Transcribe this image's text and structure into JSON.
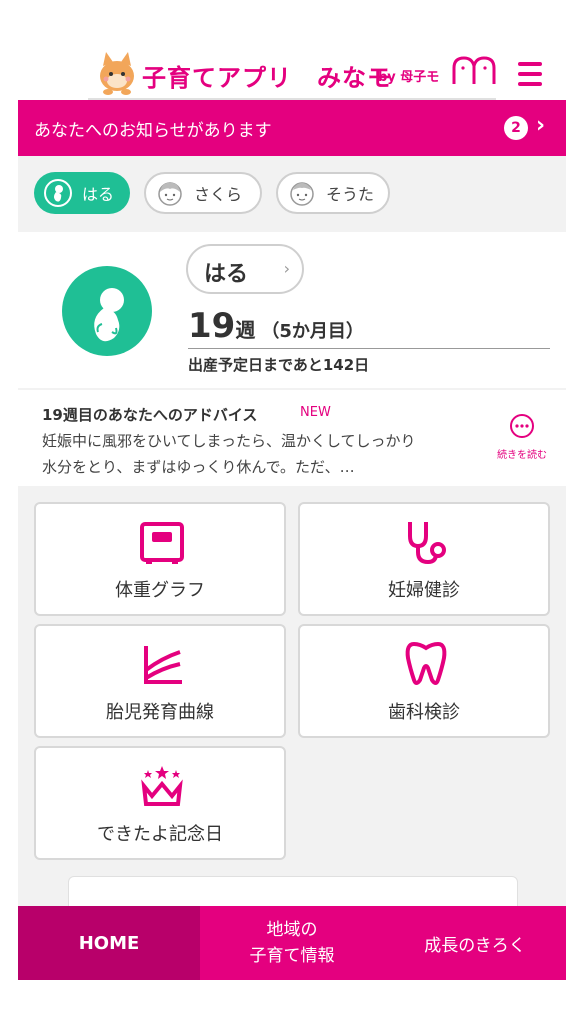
{
  "header": {
    "app_title": "子育てアプリ　みなモ",
    "by_label": "by 母子モ"
  },
  "notice": {
    "text": "あなたへのお知らせがあります",
    "count": "2"
  },
  "children": [
    {
      "name": "はる",
      "active": true
    },
    {
      "name": "さくら",
      "active": false
    },
    {
      "name": "そうた",
      "active": false
    }
  ],
  "profile": {
    "name": "はる",
    "week_number": "19",
    "week_unit": "週",
    "months": "（5か月目）",
    "due_text": "出産予定日まであと142日"
  },
  "advice": {
    "title": "19週目のあなたへのアドバイス",
    "badge": "NEW",
    "line1": "妊娠中に風邪をひいてしまったら、温かくしてしっかり",
    "line2": "水分をとり、まずはゆっくり休んで。ただ、…",
    "read_more": "続きを読む"
  },
  "menu": {
    "weight_graph": "体重グラフ",
    "checkup": "妊婦健診",
    "growth_curve": "胎児発育曲線",
    "dental": "歯科検診",
    "milestone": "できたよ記念日"
  },
  "bottom_nav": {
    "home": "HOME",
    "local_line1": "地域の",
    "local_line2": "子育て情報",
    "growth": "成長のきろく"
  },
  "colors": {
    "brand": "#e4007f",
    "brand_dark": "#b8006a",
    "accent_green": "#1fbf95"
  }
}
